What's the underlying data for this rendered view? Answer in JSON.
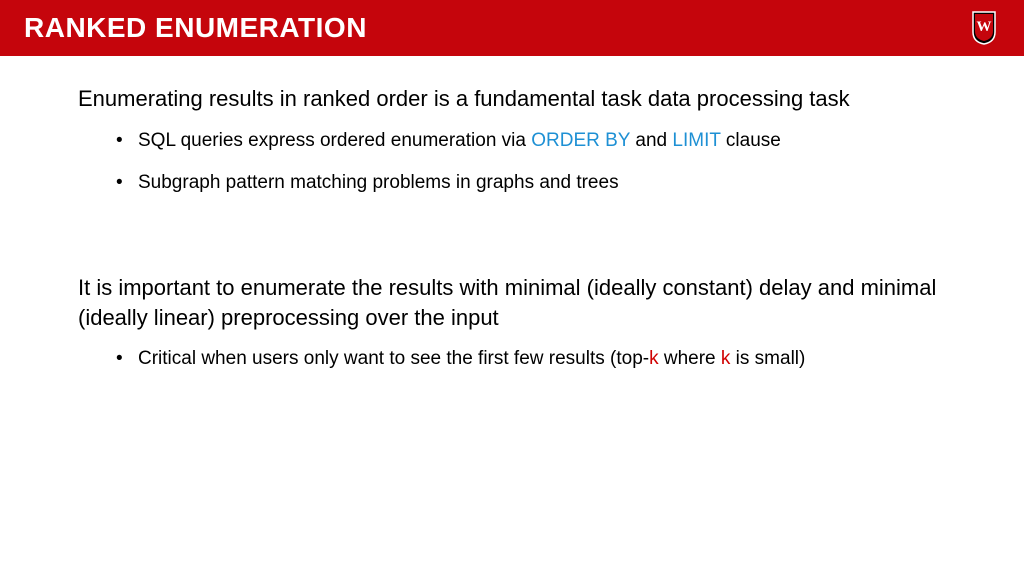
{
  "header": {
    "title": "RANKED ENUMERATION",
    "logo_name": "uw-crest-icon"
  },
  "section1": {
    "para": "Enumerating results in ranked order is a fundamental task data processing task",
    "bullet1_pre": "SQL queries express ordered enumeration via ",
    "bullet1_kw1": "ORDER BY",
    "bullet1_mid": " and ",
    "bullet1_kw2": "LIMIT",
    "bullet1_post": " clause",
    "bullet2": "Subgraph pattern matching problems in graphs and trees"
  },
  "section2": {
    "para": "It is important to enumerate the results with minimal (ideally constant) delay and minimal (ideally linear) preprocessing over the input",
    "bullet1_pre": "Critical when users only want to see the first few results (top-",
    "bullet1_kw1": "k",
    "bullet1_mid": " where ",
    "bullet1_kw2": "k",
    "bullet1_post": " is small)"
  }
}
